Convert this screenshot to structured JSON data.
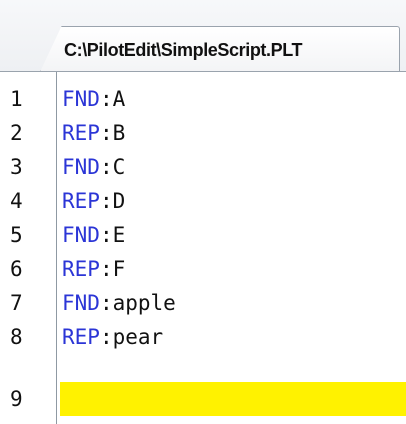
{
  "tab": {
    "title": "C:\\PilotEdit\\SimpleScript.PLT"
  },
  "lines": [
    {
      "num": "1",
      "kw": "FND",
      "sep": ":",
      "val": "A"
    },
    {
      "num": "2",
      "kw": "REP",
      "sep": ":",
      "val": "B"
    },
    {
      "num": "3",
      "kw": "FND",
      "sep": ":",
      "val": "C"
    },
    {
      "num": "4",
      "kw": "REP",
      "sep": ":",
      "val": "D"
    },
    {
      "num": "5",
      "kw": "FND",
      "sep": ":",
      "val": "E"
    },
    {
      "num": "6",
      "kw": "REP",
      "sep": ":",
      "val": "F"
    },
    {
      "num": "7",
      "kw": "FND",
      "sep": ":",
      "val": "apple"
    },
    {
      "num": "8",
      "kw": "REP",
      "sep": ":",
      "val": "pear"
    },
    {
      "num": "9",
      "kw": "",
      "sep": "",
      "val": ""
    }
  ],
  "colors": {
    "keyword": "#2b35d6",
    "current_line": "#fff200"
  }
}
